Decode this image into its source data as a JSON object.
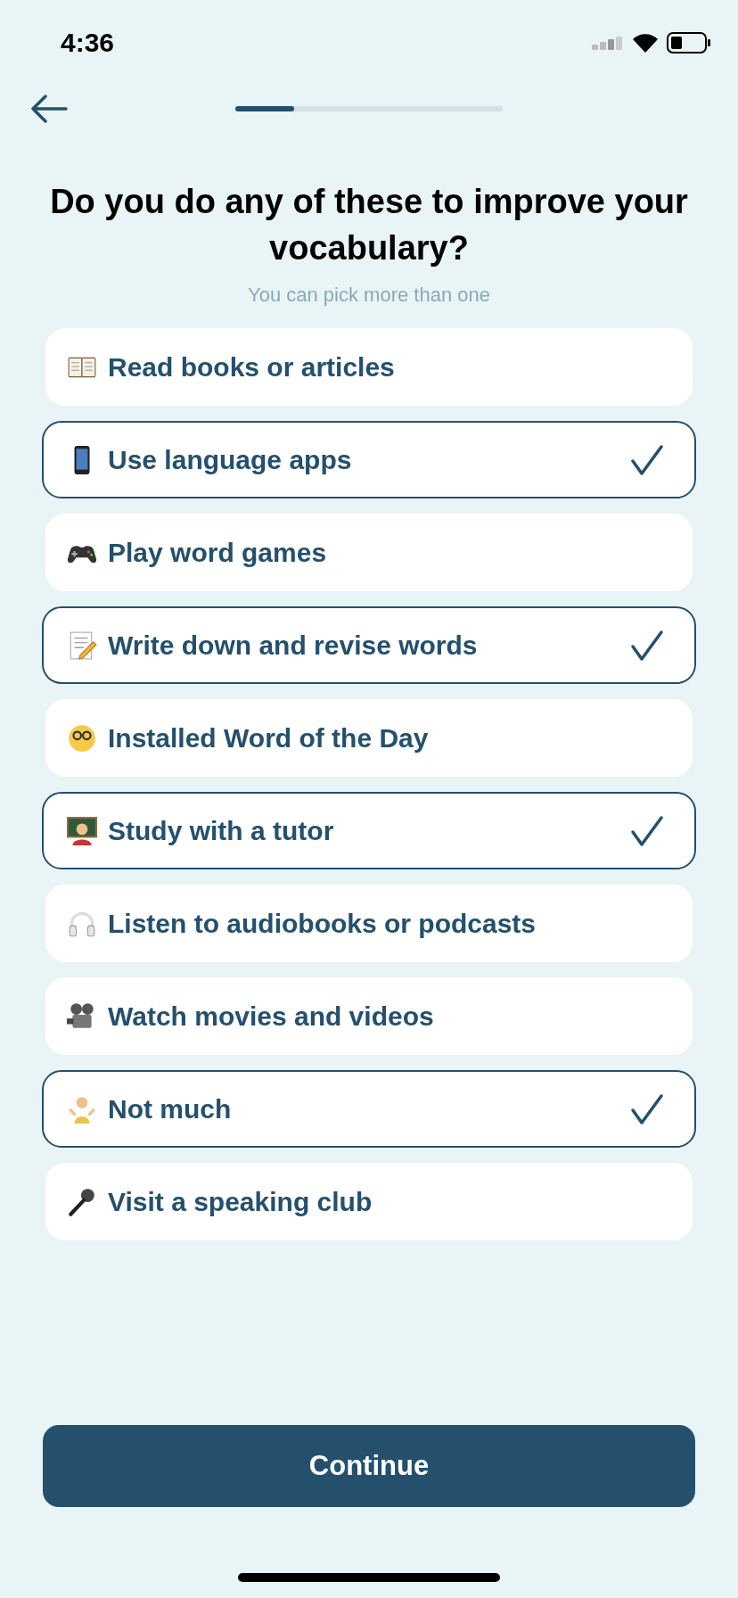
{
  "status_bar": {
    "time": "4:36"
  },
  "progress": {
    "level": 0.22
  },
  "title": "Do you do any of these to improve your vocabulary?",
  "subtitle": "You can pick more than one",
  "options": [
    {
      "label": "Read books or articles",
      "selected": false
    },
    {
      "label": "Use language apps",
      "selected": true
    },
    {
      "label": "Play word games",
      "selected": false
    },
    {
      "label": "Write down and revise words",
      "selected": true
    },
    {
      "label": "Installed Word of the Day",
      "selected": false
    },
    {
      "label": "Study with a tutor",
      "selected": true
    },
    {
      "label": "Listen to audiobooks or podcasts",
      "selected": false
    },
    {
      "label": "Watch movies and videos",
      "selected": false
    },
    {
      "label": "Not much",
      "selected": true
    },
    {
      "label": "Visit a speaking club",
      "selected": false
    }
  ],
  "continue_button": "Continue"
}
